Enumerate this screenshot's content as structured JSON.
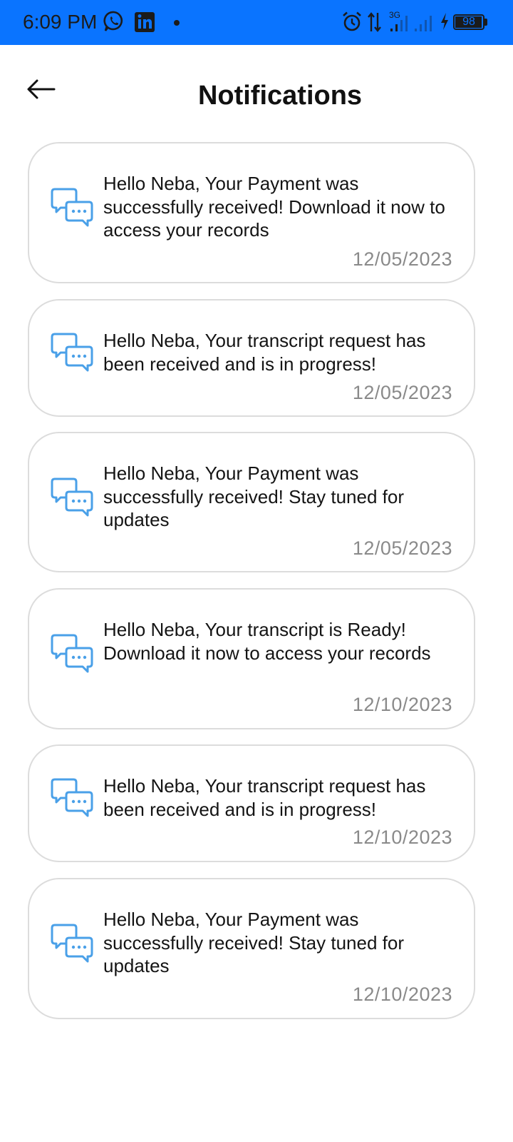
{
  "status_bar": {
    "time": "6:09 PM",
    "network": "3G",
    "battery": "98",
    "battery_level": 0.98,
    "background_color": "#0a74ff",
    "icons": [
      "whatsapp-icon",
      "linkedin-icon",
      "alarm-icon",
      "data-transfer-icon",
      "signal-icon",
      "signal-icon",
      "charging-icon",
      "battery-icon"
    ]
  },
  "header": {
    "title": "Notifications",
    "back_icon": "arrow-left-icon"
  },
  "notifications": [
    {
      "icon": "chat-bubbles-icon",
      "message": "Hello Neba, Your Payment was successfully received! Download it now to access your records",
      "date": "12/05/2023"
    },
    {
      "icon": "chat-bubbles-icon",
      "message": "Hello Neba, Your transcript request has been received and is in progress!",
      "date": "12/05/2023"
    },
    {
      "icon": "chat-bubbles-icon",
      "message": "Hello Neba, Your Payment was successfully received! Stay tuned for updates",
      "date": "12/05/2023"
    },
    {
      "icon": "chat-bubbles-icon",
      "message": "Hello Neba, Your transcript is Ready! Download it now to access your records",
      "date": "12/10/2023"
    },
    {
      "icon": "chat-bubbles-icon",
      "message": "Hello Neba, Your transcript request has been received and is in progress!",
      "date": "12/10/2023"
    },
    {
      "icon": "chat-bubbles-icon",
      "message": "Hello Neba, Your Payment was successfully received! Stay tuned for updates",
      "date": "12/10/2023"
    }
  ],
  "colors": {
    "icon_accent": "#4aa0e8",
    "card_border": "#dcdcdc",
    "date_text": "#8a8a8a"
  }
}
